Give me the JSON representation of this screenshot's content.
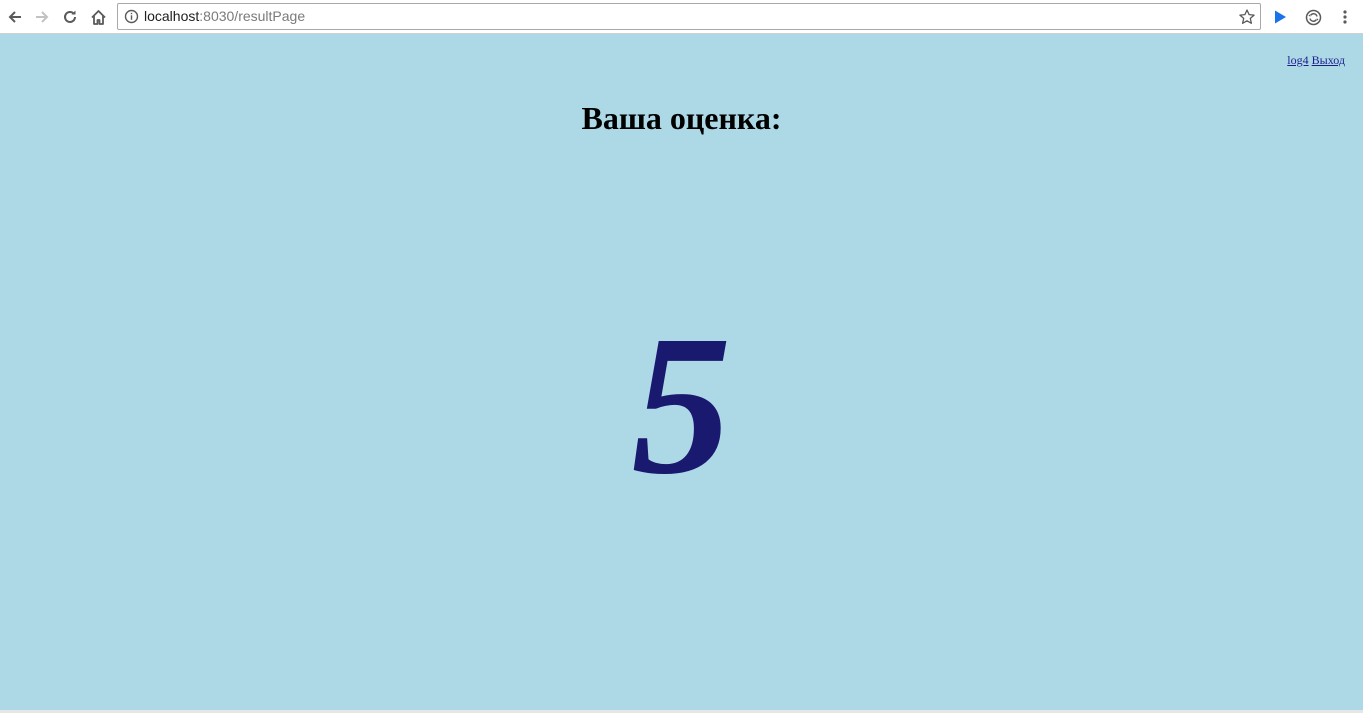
{
  "browser": {
    "url_host": "localhost",
    "url_rest": ":8030/resultPage"
  },
  "page": {
    "user_link": "log4",
    "logout_link": "Выход",
    "heading": "Ваша оценка:",
    "grade": "5"
  },
  "colors": {
    "page_background": "#add8e6",
    "grade_color": "#191970",
    "link_color": "#1c1c8c",
    "heading_color": "#000000"
  },
  "icons": {
    "back": "arrow-left-icon",
    "forward": "arrow-right-icon",
    "reload": "reload-icon",
    "home": "home-icon",
    "info": "info-icon",
    "bookmark": "star-icon",
    "extension_play": "play-icon",
    "extension_sync": "sync-icon",
    "menu": "vertical-dots-icon"
  }
}
